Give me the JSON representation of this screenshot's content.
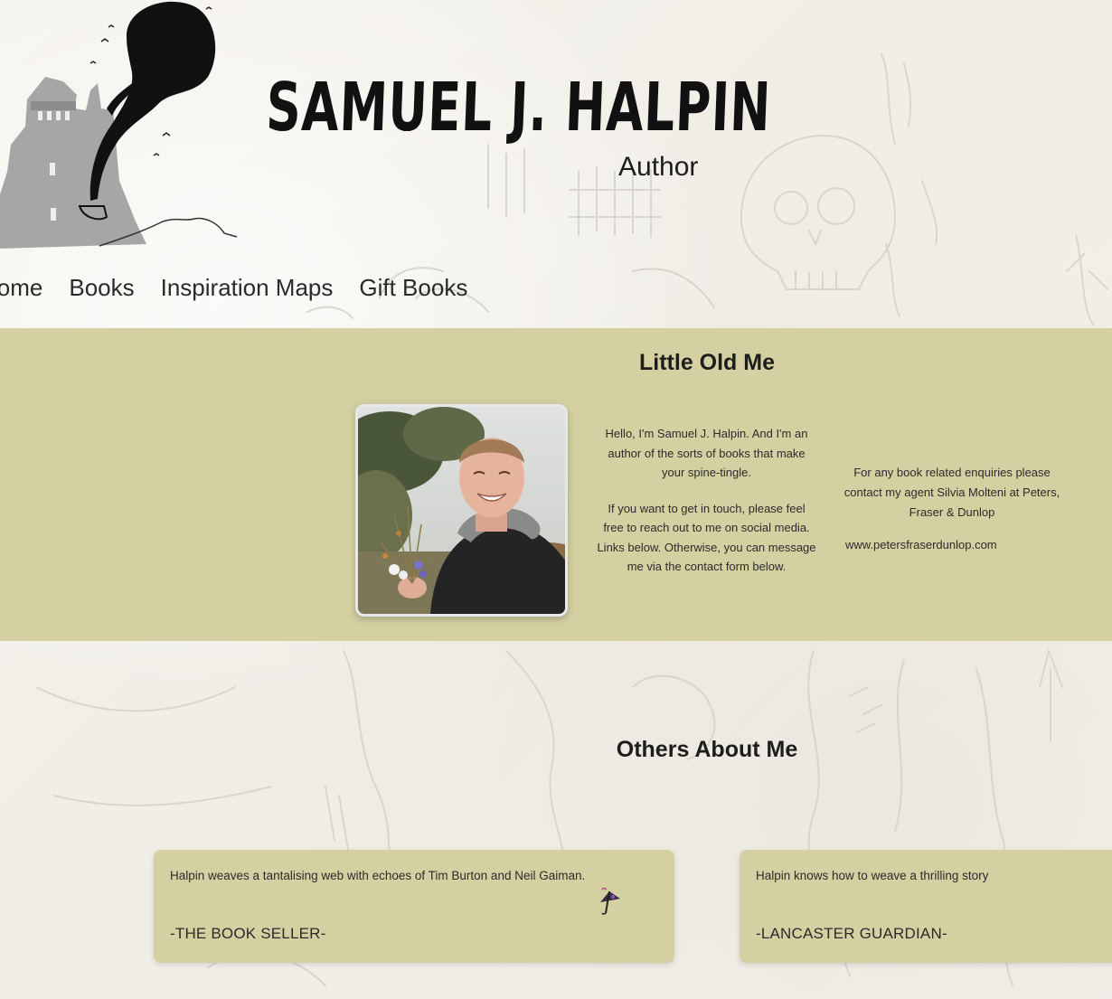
{
  "header": {
    "title": "SAMUEL J. HALPIN",
    "subtitle": "Author"
  },
  "nav": {
    "items": [
      {
        "label": "Home"
      },
      {
        "label": "Books"
      },
      {
        "label": "Inspiration Maps"
      },
      {
        "label": "Gift Books"
      }
    ]
  },
  "about": {
    "title": "Little Old Me",
    "bio_paragraph_1": "Hello, I'm Samuel J. Halpin. And I'm an author of the sorts of books that make your spine-tingle.",
    "bio_paragraph_2": "If you want to get in touch, please feel free to reach out to me on social media. Links below. Otherwise, you can message me via the contact form below.",
    "agent_text": "For any book related enquiries please contact my agent Silvia Molteni at Peters, Fraser & Dunlop",
    "agent_link": "www.petersfraserdunlop.com"
  },
  "others": {
    "title": "Others About Me",
    "reviews": [
      {
        "quote": "Halpin weaves a tantalising web with echoes of Tim Burton and Neil Gaiman.",
        "source": "-THE BOOK SELLER-"
      },
      {
        "quote": "Halpin knows how to weave a thrilling story",
        "source": "-LANCASTER GUARDIAN-"
      }
    ]
  },
  "colors": {
    "band": "#d4d0a2",
    "paper": "#f4f2ec",
    "text": "#262626"
  }
}
